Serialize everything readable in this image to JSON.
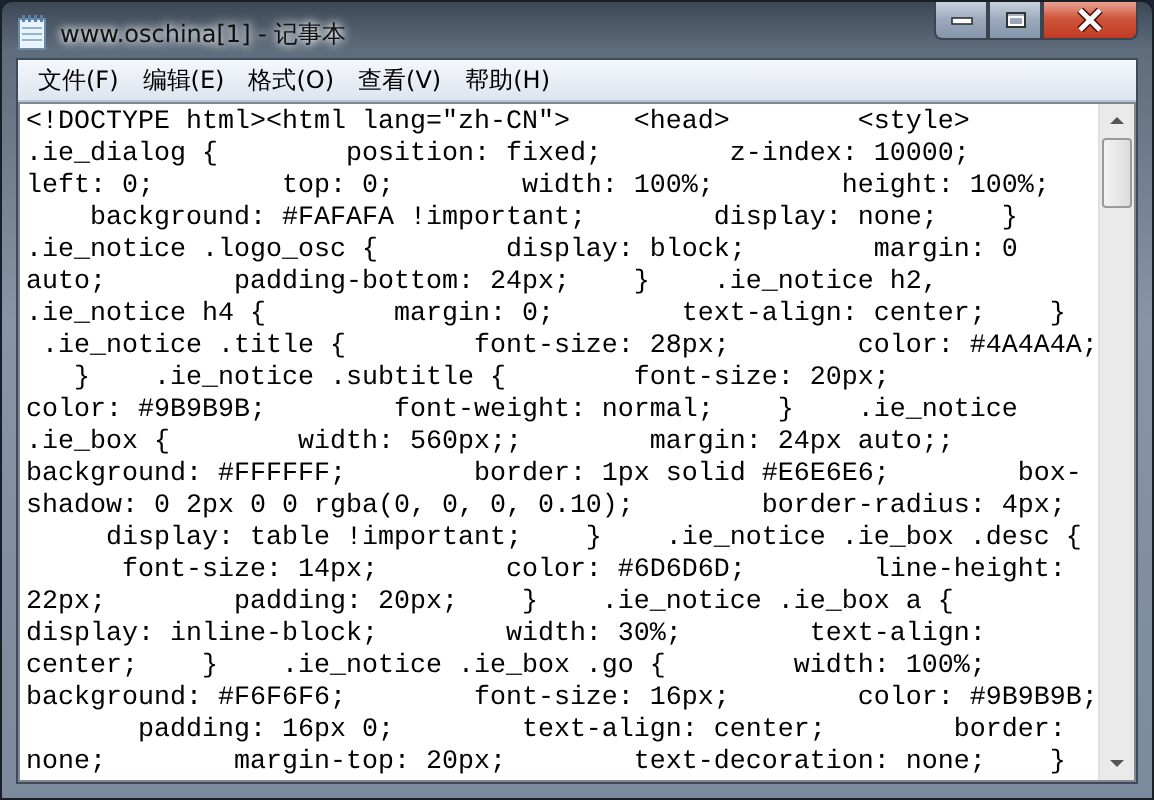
{
  "window": {
    "title": "www.oschina[1] - 记事本"
  },
  "menu": [
    {
      "label": "文件(F)"
    },
    {
      "label": "编辑(E)"
    },
    {
      "label": "格式(O)"
    },
    {
      "label": "查看(V)"
    },
    {
      "label": "帮助(H)"
    }
  ],
  "editor": {
    "lines": [
      "<!DOCTYPE html><html lang=\"zh-CN\">    <head>        <style>",
      ".ie_dialog {        position: fixed;        z-index: 10000;",
      "left: 0;        top: 0;        width: 100%;        height: 100%;",
      "    background: #FAFAFA !important;        display: none;    }",
      ".ie_notice .logo_osc {        display: block;        margin: 0",
      "auto;        padding-bottom: 24px;    }    .ie_notice h2,",
      ".ie_notice h4 {        margin: 0;        text-align: center;    }",
      " .ie_notice .title {        font-size: 28px;        color: #4A4A4A;",
      "   }    .ie_notice .subtitle {        font-size: 20px;",
      "color: #9B9B9B;        font-weight: normal;    }    .ie_notice",
      ".ie_box {        width: 560px;;        margin: 24px auto;;",
      "background: #FFFFFF;        border: 1px solid #E6E6E6;        box-",
      "shadow: 0 2px 0 0 rgba(0, 0, 0, 0.10);        border-radius: 4px;",
      "     display: table !important;    }    .ie_notice .ie_box .desc {",
      "      font-size: 14px;        color: #6D6D6D;        line-height:",
      "22px;        padding: 20px;    }    .ie_notice .ie_box a {",
      "display: inline-block;        width: 30%;        text-align:",
      "center;    }    .ie_notice .ie_box .go {        width: 100%;",
      "background: #F6F6F6;        font-size: 16px;        color: #9B9B9B;",
      "       padding: 16px 0;        text-align: center;        border:",
      "none;        margin-top: 20px;        text-decoration: none;    }"
    ]
  }
}
